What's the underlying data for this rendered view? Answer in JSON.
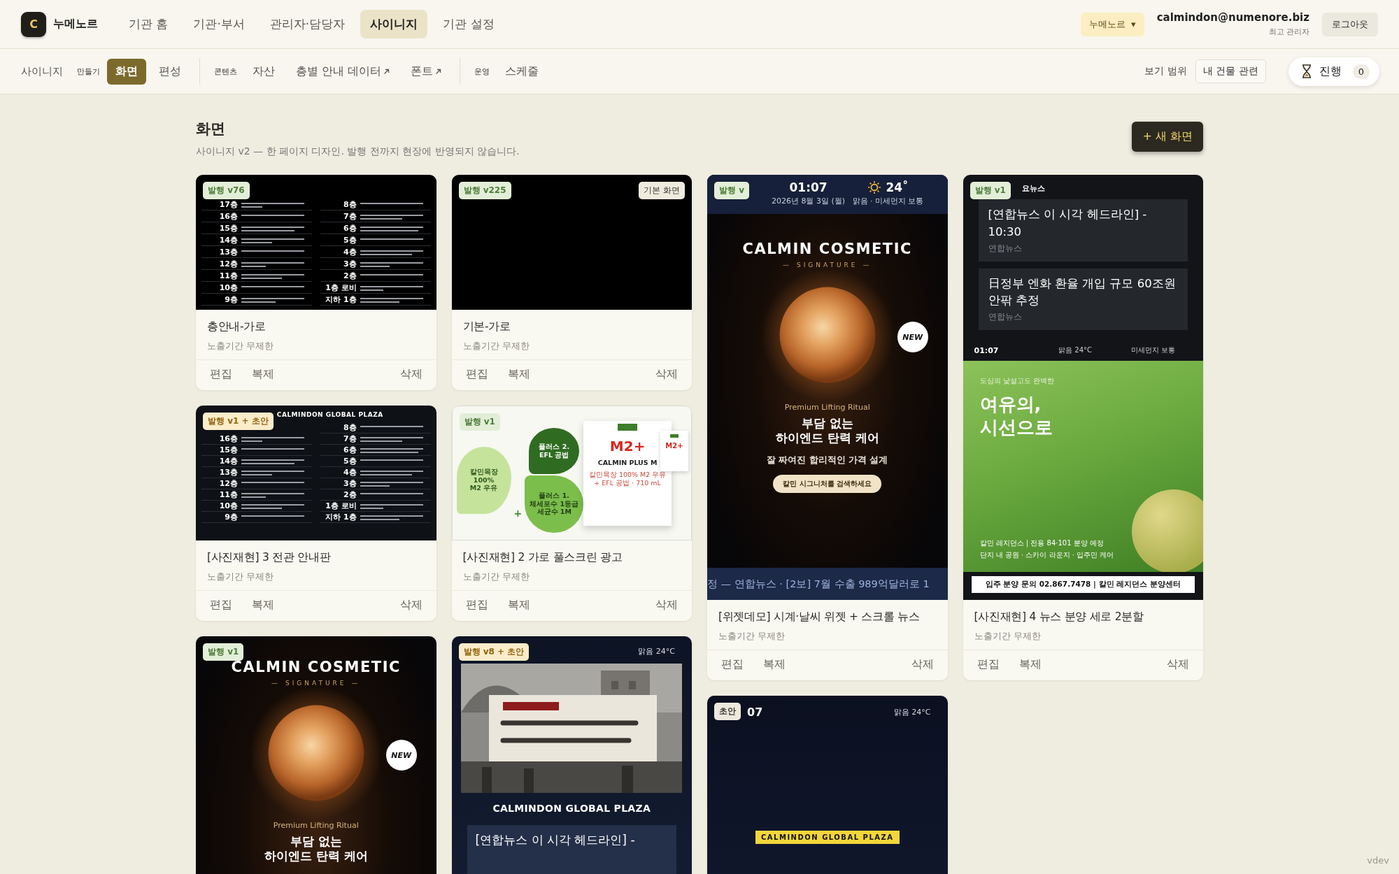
{
  "topbar": {
    "logo": "C",
    "brand": "누메노르",
    "nav": [
      {
        "label": "기관 홈",
        "selected": false
      },
      {
        "label": "기관·부서",
        "selected": false
      },
      {
        "label": "관리자·담당자",
        "selected": false
      },
      {
        "label": "사이니지",
        "selected": true
      },
      {
        "label": "기관 설정",
        "selected": false
      }
    ],
    "org_select": {
      "value": "누메노르",
      "caret": "▾"
    },
    "user": {
      "email": "calmindon@numenore.biz",
      "role": "최고 관리자"
    },
    "logout": "로그아웃"
  },
  "subnav": {
    "root": "사이니지",
    "groups": [
      {
        "label": "만들기",
        "tabs": [
          {
            "label": "화면",
            "selected": true,
            "external": false
          },
          {
            "label": "편성",
            "selected": false,
            "external": false
          }
        ]
      },
      {
        "label": "콘텐츠",
        "tabs": [
          {
            "label": "자산",
            "selected": false,
            "external": false
          },
          {
            "label": "층별 안내 데이터",
            "selected": false,
            "external": true
          },
          {
            "label": "폰트",
            "selected": false,
            "external": true
          }
        ]
      },
      {
        "label": "운영",
        "tabs": [
          {
            "label": "스케줄",
            "selected": false,
            "external": false
          }
        ]
      }
    ],
    "scope_label": "보기 범위",
    "scope_value": "내 건물 관련",
    "progress": {
      "label": "진행",
      "count": "0"
    }
  },
  "page": {
    "title": "화면",
    "subtitle": "사이니지 v2 — 한 페이지 디자인. 발행 전까지 현장에 반영되지 않습니다.",
    "new_button": "+ 새 화면"
  },
  "columns": [
    [
      {
        "badge": {
          "text": "발행 v76",
          "kind": "published"
        },
        "preview": {
          "kind": "directory",
          "floors_left": [
            "17층",
            "16층",
            "15층",
            "14층",
            "13층",
            "12층",
            "11층",
            "10층",
            "9층"
          ],
          "floors_right": [
            "8층",
            "7층",
            "6층",
            "5층",
            "4층",
            "3층",
            "2층",
            "1층 로비",
            "지하 1층"
          ]
        },
        "title": "층안내-가로",
        "period": "노출기간 무제한",
        "actions": [
          {
            "label": "편집",
            "kind": "edit"
          },
          {
            "label": "복제",
            "kind": "duplicate"
          },
          {
            "label": "삭제",
            "kind": "delete"
          }
        ]
      },
      {
        "badge": {
          "text": "발행 v1 + 초안",
          "kind": "mixed"
        },
        "preview": {
          "kind": "directory",
          "header": "CALMINDON GLOBAL PLAZA",
          "floors_left": [
            "16층",
            "15층",
            "14층",
            "13층",
            "12층",
            "11층",
            "10층",
            "9층"
          ],
          "floors_right": [
            "8층",
            "7층",
            "6층",
            "5층",
            "4층",
            "3층",
            "2층",
            "1층 로비",
            "지하 1층"
          ]
        },
        "title": "[사진재현] 3 전관 안내판",
        "period": "노출기간 무제한",
        "actions": [
          {
            "label": "편집",
            "kind": "edit"
          },
          {
            "label": "복제",
            "kind": "duplicate"
          },
          {
            "label": "삭제",
            "kind": "delete"
          }
        ]
      },
      {
        "badge": {
          "text": "발행 v1",
          "kind": "published"
        },
        "preview": {
          "kind": "cosmetic",
          "brand": "CALMIN COSMETIC",
          "line": "— SIGNATURE —",
          "new": "NEW",
          "ritual": "Premium Lifting Ritual",
          "headline": "부담 없는\n하이엔드 탄력 케어"
        }
      }
    ],
    [
      {
        "badge": {
          "text": "발행 v225",
          "kind": "published"
        },
        "tag": "기본 화면",
        "preview": {
          "kind": "blank"
        },
        "title": "기본-가로",
        "period": "노출기간 무제한",
        "actions": [
          {
            "label": "편집",
            "kind": "edit"
          },
          {
            "label": "복제",
            "kind": "duplicate"
          },
          {
            "label": "삭제",
            "kind": "delete"
          }
        ]
      },
      {
        "badge": {
          "text": "발행 v1",
          "kind": "published"
        },
        "preview": {
          "kind": "product_ad",
          "bubbles": [
            "칼민목장\n100%\nM2 우유",
            "플러스 2.\nEFL 공법",
            "플러스 1.\n체세포수 1등급\n세균수 1M"
          ],
          "plus": "+",
          "product": "M2+",
          "product_name": "CALMIN PLUS M",
          "product_note": "칼민목장 100% M2 우유\n+ EFL 공법 · 710 mL",
          "mini_product": "M2+"
        },
        "title": "[사진재현] 2 가로 풀스크린 광고",
        "period": "노출기간 무제한",
        "actions": [
          {
            "label": "편집",
            "kind": "edit"
          },
          {
            "label": "복제",
            "kind": "duplicate"
          },
          {
            "label": "삭제",
            "kind": "delete"
          }
        ]
      },
      {
        "badge": {
          "text": "발행 v8 + 초안",
          "kind": "mixed"
        },
        "preview": {
          "kind": "plaza",
          "weather": "맑음 24°C",
          "name": "CALMINDON GLOBAL PLAZA",
          "news": "[연합뉴스 이 시각 헤드라인] -"
        }
      }
    ],
    [
      {
        "badge": {
          "text": "발행 v",
          "kind": "published"
        },
        "preview": {
          "kind": "cosmetic",
          "widget": {
            "time": "01:07",
            "date": "2026년 8월 3일 (월)",
            "temp": "24˚",
            "weather": "맑음 · 미세먼지 보통"
          },
          "brand": "CALMIN COSMETIC",
          "line": "— SIGNATURE —",
          "new": "NEW",
          "ritual": "Premium Lifting Ritual",
          "headline": "부담 없는\n하이엔드 탄력 케어",
          "tagline": "잘 짜여진 합리적인 가격 설계",
          "cta": "칼민 시그니처를 검색하세요",
          "ticker": "정 — 연합뉴스  ·  [2보] 7월 수출 989억달러로 1"
        },
        "title": "[위젯데모] 시계·날씨 위젯 + 스크롤 뉴스",
        "period": "노출기간 무제한",
        "actions": [
          {
            "label": "편집",
            "kind": "edit"
          },
          {
            "label": "복제",
            "kind": "duplicate"
          },
          {
            "label": "삭제",
            "kind": "delete"
          }
        ]
      },
      {
        "badge": {
          "text": "초안",
          "kind": "draft"
        },
        "preview": {
          "kind": "clock",
          "time": "07",
          "weather": "맑음 24°C",
          "label": "CALMINDON GLOBAL PLAZA"
        }
      }
    ],
    [
      {
        "badge": {
          "text": "발행 v1",
          "kind": "published"
        },
        "preview": {
          "kind": "news_split",
          "header": "요뉴스",
          "news": [
            {
              "title": "[연합뉴스 이 시각 헤드라인] - 10:30",
              "source": "연합뉴스"
            },
            {
              "title": "日정부 엔화 환율 개입 규모 60조원 안팎 추정",
              "source": "연합뉴스"
            }
          ],
          "status": [
            "01:07",
            "맑음 24°C",
            "미세먼지 보통"
          ],
          "eyebrow": "도심의 낯설고도 완벽한",
          "headline": "여유의,\n시선으로",
          "details": [
            "칼민 레지던스  |  전용 84·101 분양 예정",
            "단지 내 공원 · 스카이 라운지 · 입주민 케어"
          ],
          "footer": "입주 분양 문의 02.867.7478  |  칼민 레지던스 분양센터"
        },
        "title": "[사진재현] 4 뉴스 분양 세로 2분할",
        "period": "노출기간 무제한",
        "actions": [
          {
            "label": "편집",
            "kind": "edit"
          },
          {
            "label": "복제",
            "kind": "duplicate"
          },
          {
            "label": "삭제",
            "kind": "delete"
          }
        ]
      }
    ]
  ],
  "footer_tag": "vdev"
}
